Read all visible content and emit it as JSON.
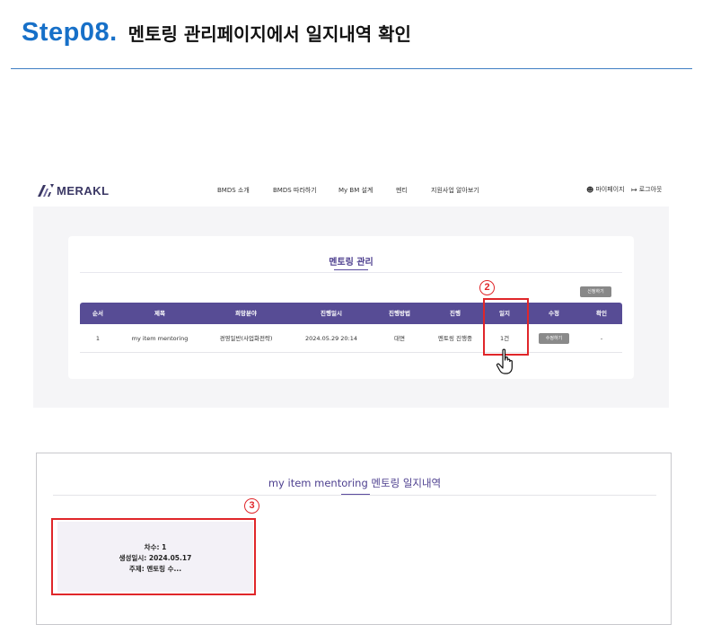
{
  "header": {
    "step": "Step08.",
    "title": "멘토링 관리페이지에서 일지내역 확인"
  },
  "app": {
    "logo_text": "MERAKL",
    "nav": [
      "BMDS 소개",
      "BMDS 따라하기",
      "My BM 설계",
      "멘티",
      "지원사업 알아보기"
    ],
    "mypage": "마이페이지",
    "logout": "로그아웃"
  },
  "mentoring": {
    "title": "멘토링 관리",
    "apply_button": "신청하기",
    "columns": [
      "순서",
      "제목",
      "희망분야",
      "진행일시",
      "진행방법",
      "진행",
      "일지",
      "수정",
      "확인"
    ],
    "rows": [
      {
        "order": "1",
        "subject": "my item mentoring",
        "field": "경영일반(사업화전략)",
        "datetime": "2024.05.29 20:14",
        "method": "대면",
        "status": "멘토링 진행중",
        "journal": "1건",
        "edit": "수정하기",
        "confirm": "-"
      }
    ]
  },
  "annotations": {
    "badge2": "2",
    "badge3": "3"
  },
  "journal": {
    "title": "my item mentoring 멘토링 일지내역",
    "entry": {
      "round": "차수: 1",
      "created": "생성일시: 2024.05.17",
      "topic": "주제: 멘토링 수..."
    }
  },
  "colors": {
    "step_blue": "#1770c8",
    "accent_purple": "#574c95",
    "highlight_red": "#e0262a"
  }
}
